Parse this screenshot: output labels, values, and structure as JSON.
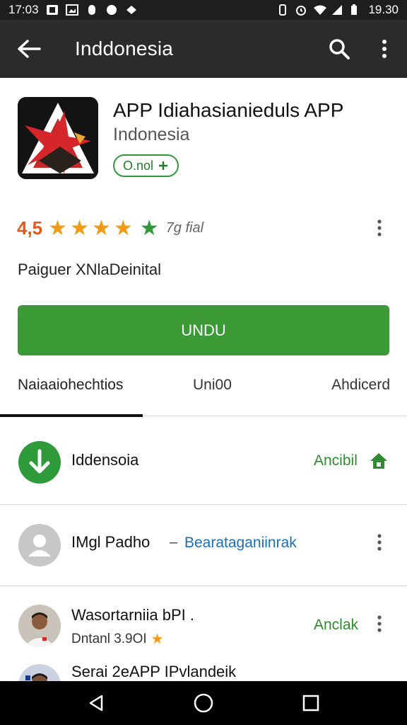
{
  "status_bar": {
    "time_left": "17:03",
    "time_right": "19.30"
  },
  "app_bar": {
    "title": "Inddonesia"
  },
  "app": {
    "name": "APP Idiahasianieduls APP",
    "developer": "Indonesia",
    "badge_label": "O.nol"
  },
  "rating": {
    "score": "4,5",
    "count": "7g fial"
  },
  "category": "Paiguer XNlaDeinital",
  "install_label": "UNDU",
  "tabs": [
    {
      "label": "Naiaaiohechtios"
    },
    {
      "label": "Uni00"
    },
    {
      "label": "Ahdicerd"
    }
  ],
  "list": [
    {
      "title": "Iddensoia",
      "action": "Ancibil"
    },
    {
      "title": "IMgl Padho",
      "dash": "–",
      "link": "Bearataganiinrak"
    },
    {
      "title": "Wasortarniia bPI .",
      "subtitle": "Dntanl 3.9OI",
      "action": "Anclak"
    },
    {
      "title": "Serai 2eAPP IPvlandeik"
    }
  ],
  "colors": {
    "accent_green": "#3b9a35",
    "rating_orange": "#f29a12",
    "link_blue": "#1a6fb8",
    "app_bar": "#2b2b2b"
  }
}
